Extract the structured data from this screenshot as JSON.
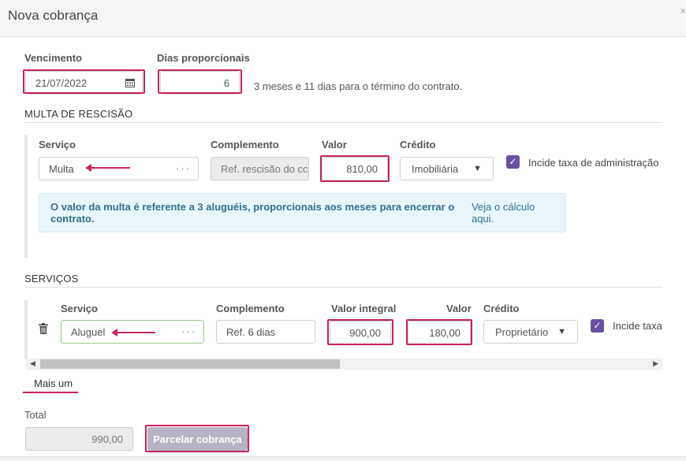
{
  "dialog": {
    "title": "Nova cobrança",
    "close_label": "×"
  },
  "top": {
    "vencimento_label": "Vencimento",
    "vencimento_value": "21/07/2022",
    "dias_label": "Dias proporcionais",
    "dias_value": "6",
    "note": "3 meses e 11 dias para o término do contrato."
  },
  "multa": {
    "section_title": "MULTA DE RESCISÃO",
    "servico_label": "Serviço",
    "servico_value": "Multa",
    "complemento_label": "Complemento",
    "complemento_value": "Ref. rescisão do cc",
    "valor_label": "Valor",
    "valor_value": "810,00",
    "credito_label": "Crédito",
    "credito_value": "Imobiliária",
    "incide_label": "Incide taxa de administração",
    "incide_checked": true,
    "info_strong": "O valor da multa é referente a 3 aluguéis, proporcionais aos meses para encerrar o contrato.",
    "info_link": "Veja o cálculo aqui."
  },
  "servicos": {
    "section_title": "SERVIÇOS",
    "servico_label": "Serviço",
    "servico_value": "Aluguel",
    "complemento_label": "Complemento",
    "complemento_value": "Ref. 6 dias",
    "valor_integral_label": "Valor integral",
    "valor_integral_value": "900,00",
    "valor_label": "Valor",
    "valor_value": "180,00",
    "credito_label": "Crédito",
    "credito_value": "Proprietário",
    "incide_label": "Incide taxa",
    "incide_checked": true,
    "add_more": "Mais um"
  },
  "footer": {
    "total_label": "Total",
    "total_value": "990,00",
    "button_label": "Parcelar cobrança"
  },
  "colors": {
    "highlight": "#c8245b",
    "checkbox": "#6a4fa3",
    "info_bg": "#e9f6f9"
  }
}
